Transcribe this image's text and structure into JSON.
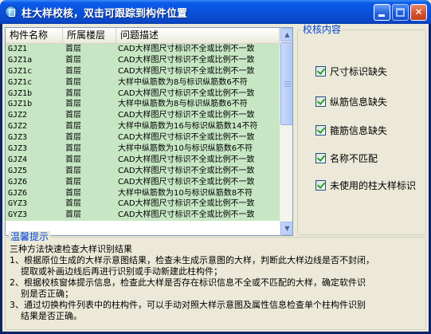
{
  "window": {
    "title": "柱大样校核，双击可跟踪到构件位置"
  },
  "list": {
    "columns": [
      "构件名称",
      "所属楼层",
      "问题描述"
    ],
    "rows": [
      [
        "GJZ1",
        "首层",
        "CAD大样图尺寸标识不全或比例不一致"
      ],
      [
        "GJZ1a",
        "首层",
        "CAD大样图尺寸标识不全或比例不一致"
      ],
      [
        "GJZ1c",
        "首层",
        "CAD大样图尺寸标识不全或比例不一致"
      ],
      [
        "GJZ1c",
        "首层",
        "大样中纵筋数为8与标识纵筋数6不符"
      ],
      [
        "GJZ1b",
        "首层",
        "CAD大样图尺寸标识不全或比例不一致"
      ],
      [
        "GJZ1b",
        "首层",
        "大样中纵筋数为8与标识纵筋数6不符"
      ],
      [
        "GJZ2",
        "首层",
        "CAD大样图尺寸标识不全或比例不一致"
      ],
      [
        "GJZ2",
        "首层",
        "大样中纵筋数为16与标识纵筋数14不符"
      ],
      [
        "GJZ3",
        "首层",
        "CAD大样图尺寸标识不全或比例不一致"
      ],
      [
        "GJZ3",
        "首层",
        "大样中纵筋数为10与标识纵筋数6不符"
      ],
      [
        "GJZ4",
        "首层",
        "CAD大样图尺寸标识不全或比例不一致"
      ],
      [
        "GJZ5",
        "首层",
        "CAD大样图尺寸标识不全或比例不一致"
      ],
      [
        "GJZ6",
        "首层",
        "CAD大样图尺寸标识不全或比例不一致"
      ],
      [
        "GJZ6",
        "首层",
        "大样中纵筋数为10与标识纵筋数8不符"
      ],
      [
        "GYZ3",
        "首层",
        "CAD大样图尺寸标识不全或比例不一致"
      ],
      [
        "GYZ3",
        "首层",
        "CAD大样图尺寸标识不全或比例不一致"
      ]
    ]
  },
  "check_group": {
    "title": "校核内容",
    "items": [
      {
        "label": "尺寸标识缺失",
        "checked": true
      },
      {
        "label": "纵筋信息缺失",
        "checked": true
      },
      {
        "label": "箍筋信息缺失",
        "checked": true
      },
      {
        "label": "名称不匹配",
        "checked": true
      },
      {
        "label": "未使用的柱大样标识",
        "checked": true
      }
    ]
  },
  "tips": {
    "title": "温馨提示",
    "lines": [
      "三种方法快速检查大样识别结果",
      "1、根据原位生成的大样示意图结果，检查未生成示意图的大样，判断此大样边线是否不封闭，",
      "提取或补画边线后再进行识别或手动新建此柱构件；",
      "2、根据校核窗体提示信息，检查此大样是否存在标识信息不全或不匹配的大样，确定软件识",
      "别是否正确；",
      "3、通过切换构件列表中的柱构件，可以手动对照大样示意图及属性信息检查单个柱构件识别",
      "结果是否正确。"
    ]
  },
  "colors": {
    "row_background": "#C7E7C4",
    "group_title": "#0046D5",
    "titlebar": "#0A4FD8"
  }
}
